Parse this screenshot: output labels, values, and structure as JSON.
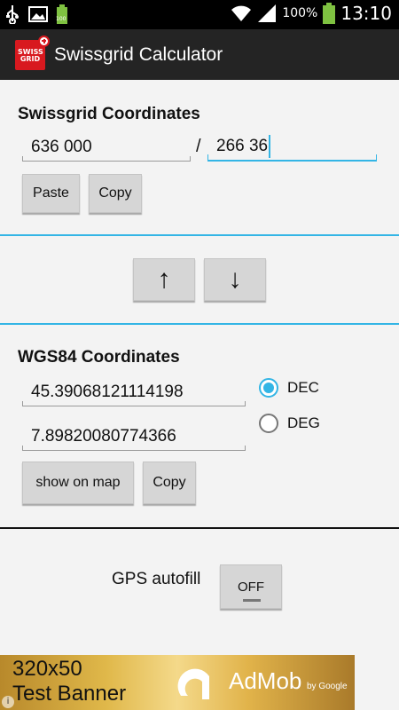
{
  "status_bar": {
    "battery_percent": "100%",
    "small_battery_label": "100",
    "time": "13:10",
    "icons": [
      "usb-icon",
      "image-icon",
      "battery-small-icon",
      "wifi-icon",
      "signal-icon",
      "battery-icon"
    ]
  },
  "app_bar": {
    "logo_text": "SWISS GRID",
    "title": "Swissgrid Calculator"
  },
  "swissgrid": {
    "title": "Swissgrid Coordinates",
    "x_value": "636 000",
    "separator": "/",
    "y_value": "266 36",
    "paste_label": "Paste",
    "copy_label": "Copy"
  },
  "convert": {
    "up_label": "↑",
    "down_label": "↓"
  },
  "wgs84": {
    "title": "WGS84 Coordinates",
    "lat_value": "45.39068121114198",
    "lon_value": "7.89820080774366",
    "radio_dec": "DEC",
    "radio_deg": "DEG",
    "selected_format": "DEC",
    "show_map_label": "show on map",
    "copy_label": "Copy"
  },
  "gps": {
    "label": "GPS autofill",
    "toggle_state": "OFF"
  },
  "ad_banner": {
    "size_text": "320x50",
    "subtitle": "Test Banner",
    "brand": "AdMob",
    "by_text": "by Google"
  },
  "colors": {
    "accent": "#33b5e5",
    "action_bar": "#242424",
    "logo_red": "#d8191f"
  }
}
